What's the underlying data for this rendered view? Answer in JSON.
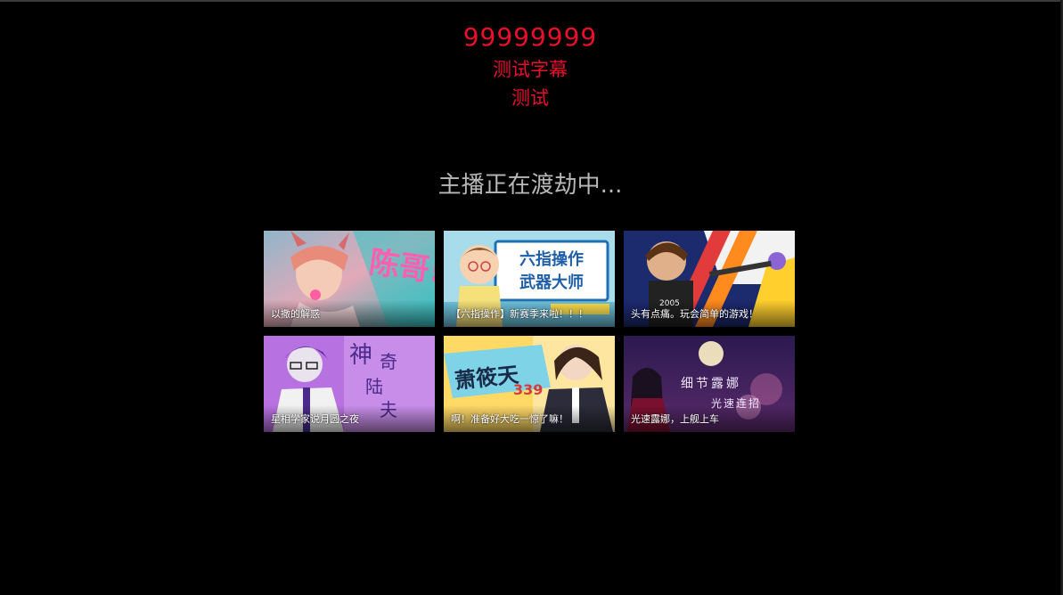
{
  "overlay": {
    "number": "99999999",
    "subtitle": "测试字幕",
    "test_text": "测试",
    "color": "#e8102a"
  },
  "status": {
    "text": "主播正在渡劫中..."
  },
  "cards": [
    {
      "title": "以撒的解惑",
      "art_text": "陈哥!"
    },
    {
      "title": "【六指操作】新赛季来啦！！！",
      "art_text_1": "六指操作",
      "art_text_2": "武器大师"
    },
    {
      "title": "头有点痛。玩会简单的游戏！",
      "art_text": "2005"
    },
    {
      "title": "星相学家说月圆之夜",
      "art_text_1": "神",
      "art_text_2": "奇",
      "art_text_3": "陆",
      "art_text_4": "夫"
    },
    {
      "title": "啊！准备好大吃一惊了嘛！",
      "art_text_1": "萧筱天",
      "art_text_2": "339"
    },
    {
      "title": "光速露娜，上舰上车",
      "art_text_1": "细节露娜",
      "art_text_2": "光速连招"
    }
  ]
}
